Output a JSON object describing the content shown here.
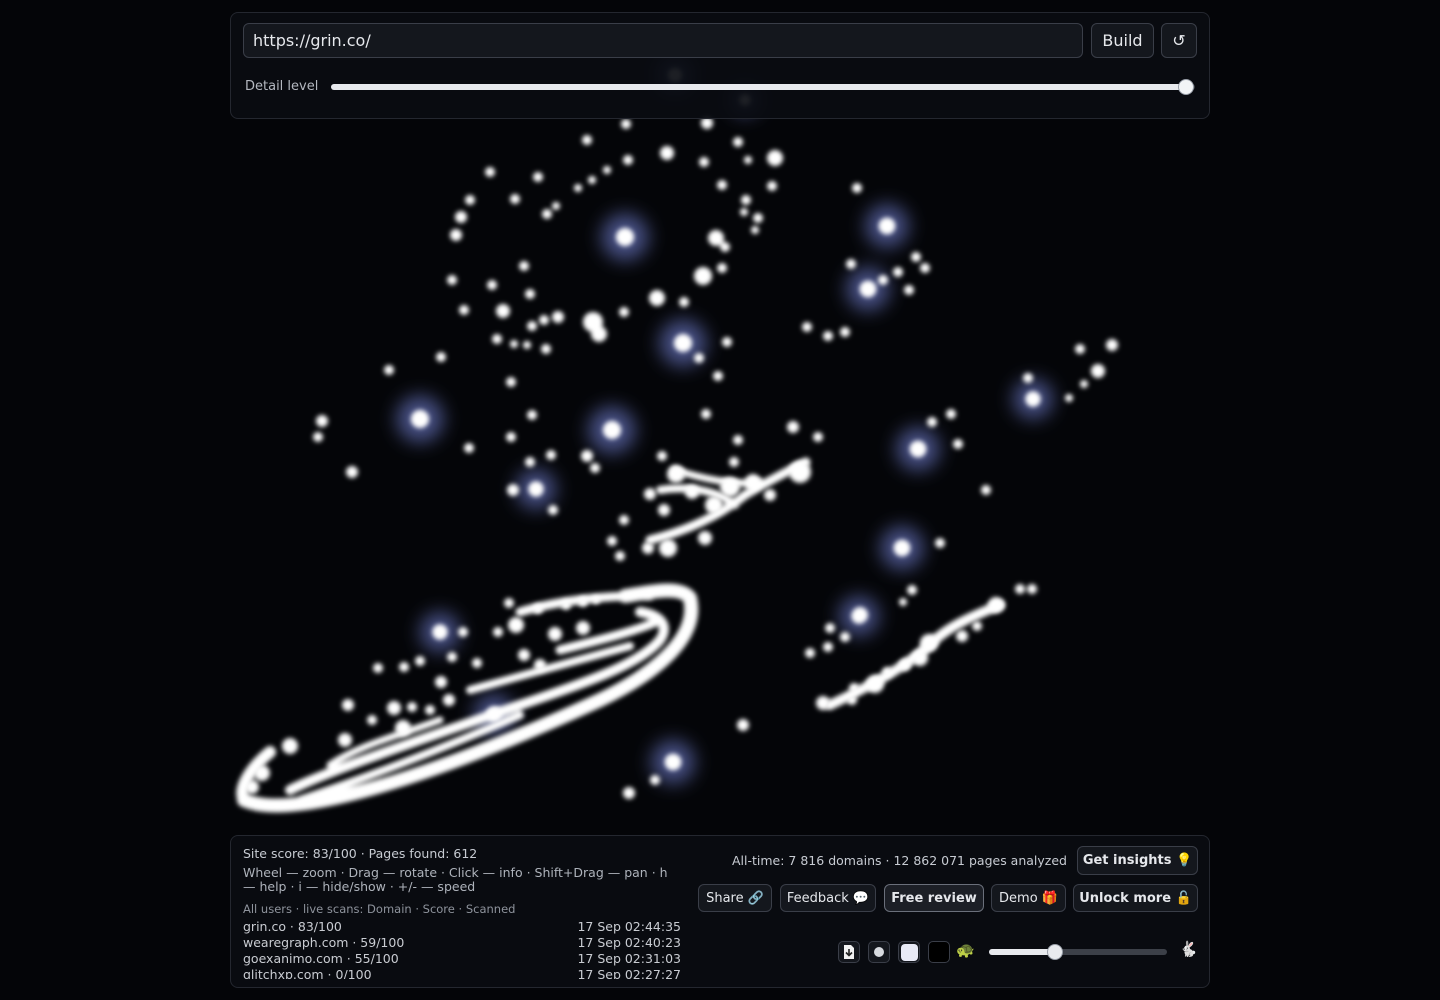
{
  "top_bar": {
    "url_value": "https://grin.co/",
    "build_label": "Build",
    "reset_icon": "reload-icon",
    "reset_glyph": "↺",
    "detail_label": "Detail level",
    "detail_level": 0.99
  },
  "stats": {
    "site_summary": "Site score: 83/100 · Pages found: 612",
    "help_text": "Wheel — zoom · Drag — rotate · Click — info · Shift+Drag — pan · h — help · i — hide/show · +/- — speed",
    "scans_header": "All users · live scans: Domain · Score · Scanned",
    "scans": [
      {
        "domain": "grin.co · 83/100",
        "time": "17 Sep 02:44:35"
      },
      {
        "domain": "wearegraph.com · 59/100",
        "time": "17 Sep 02:40:23"
      },
      {
        "domain": "goexanimo.com · 55/100",
        "time": "17 Sep 02:31:03"
      },
      {
        "domain": "glitchxp.com · 0/100",
        "time": "17 Sep 02:27:27"
      }
    ],
    "alltime": "All-time: 7 816 domains · 12 862 071 pages analyzed"
  },
  "actions": {
    "insights_label": "Get insights 💡",
    "share_label": "Share 🔗",
    "feedback_label": "Feedback 💬",
    "review_label": "Free review",
    "demo_label": "Demo 🎁",
    "unlock_label": "Unlock more 🔓"
  },
  "controls": {
    "icons": [
      "download-icon",
      "dot-small-icon",
      "dot-large-icon",
      "dark-background-icon",
      "turtle-icon",
      "rabbit-icon"
    ],
    "turtle_glyph": "🐢",
    "rabbit_glyph": "🐇",
    "speed_level": 0.37
  },
  "colors": {
    "background": "#040508",
    "glow": "#ffffff",
    "halo": "#6c79c8",
    "panel": "#0a0c11"
  }
}
